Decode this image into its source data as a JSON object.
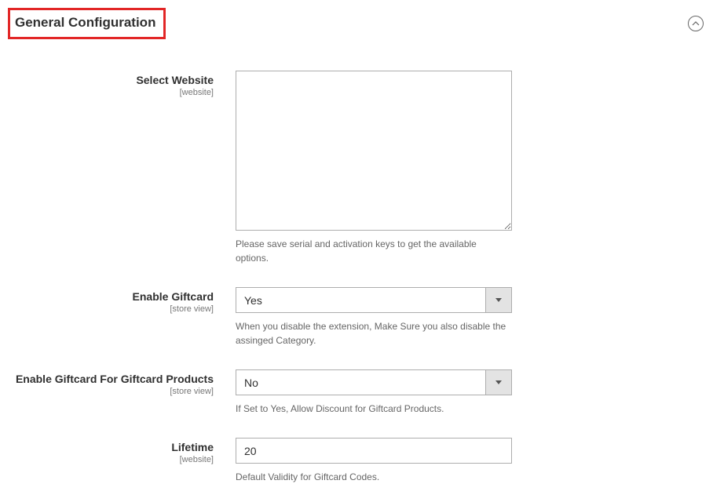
{
  "section": {
    "title": "General Configuration"
  },
  "fields": {
    "select_website": {
      "label": "Select Website",
      "scope": "[website]",
      "help": "Please save serial and activation keys to get the available options."
    },
    "enable_giftcard": {
      "label": "Enable Giftcard",
      "scope": "[store view]",
      "value": "Yes",
      "help": "When you disable the extension, Make Sure you also disable the assinged Category."
    },
    "enable_giftcard_products": {
      "label": "Enable Giftcard For Giftcard Products",
      "scope": "[store view]",
      "value": "No",
      "help": "If Set to Yes, Allow Discount for Giftcard Products."
    },
    "lifetime": {
      "label": "Lifetime",
      "scope": "[website]",
      "value": "20",
      "help": "Default Validity for Giftcard Codes."
    }
  }
}
